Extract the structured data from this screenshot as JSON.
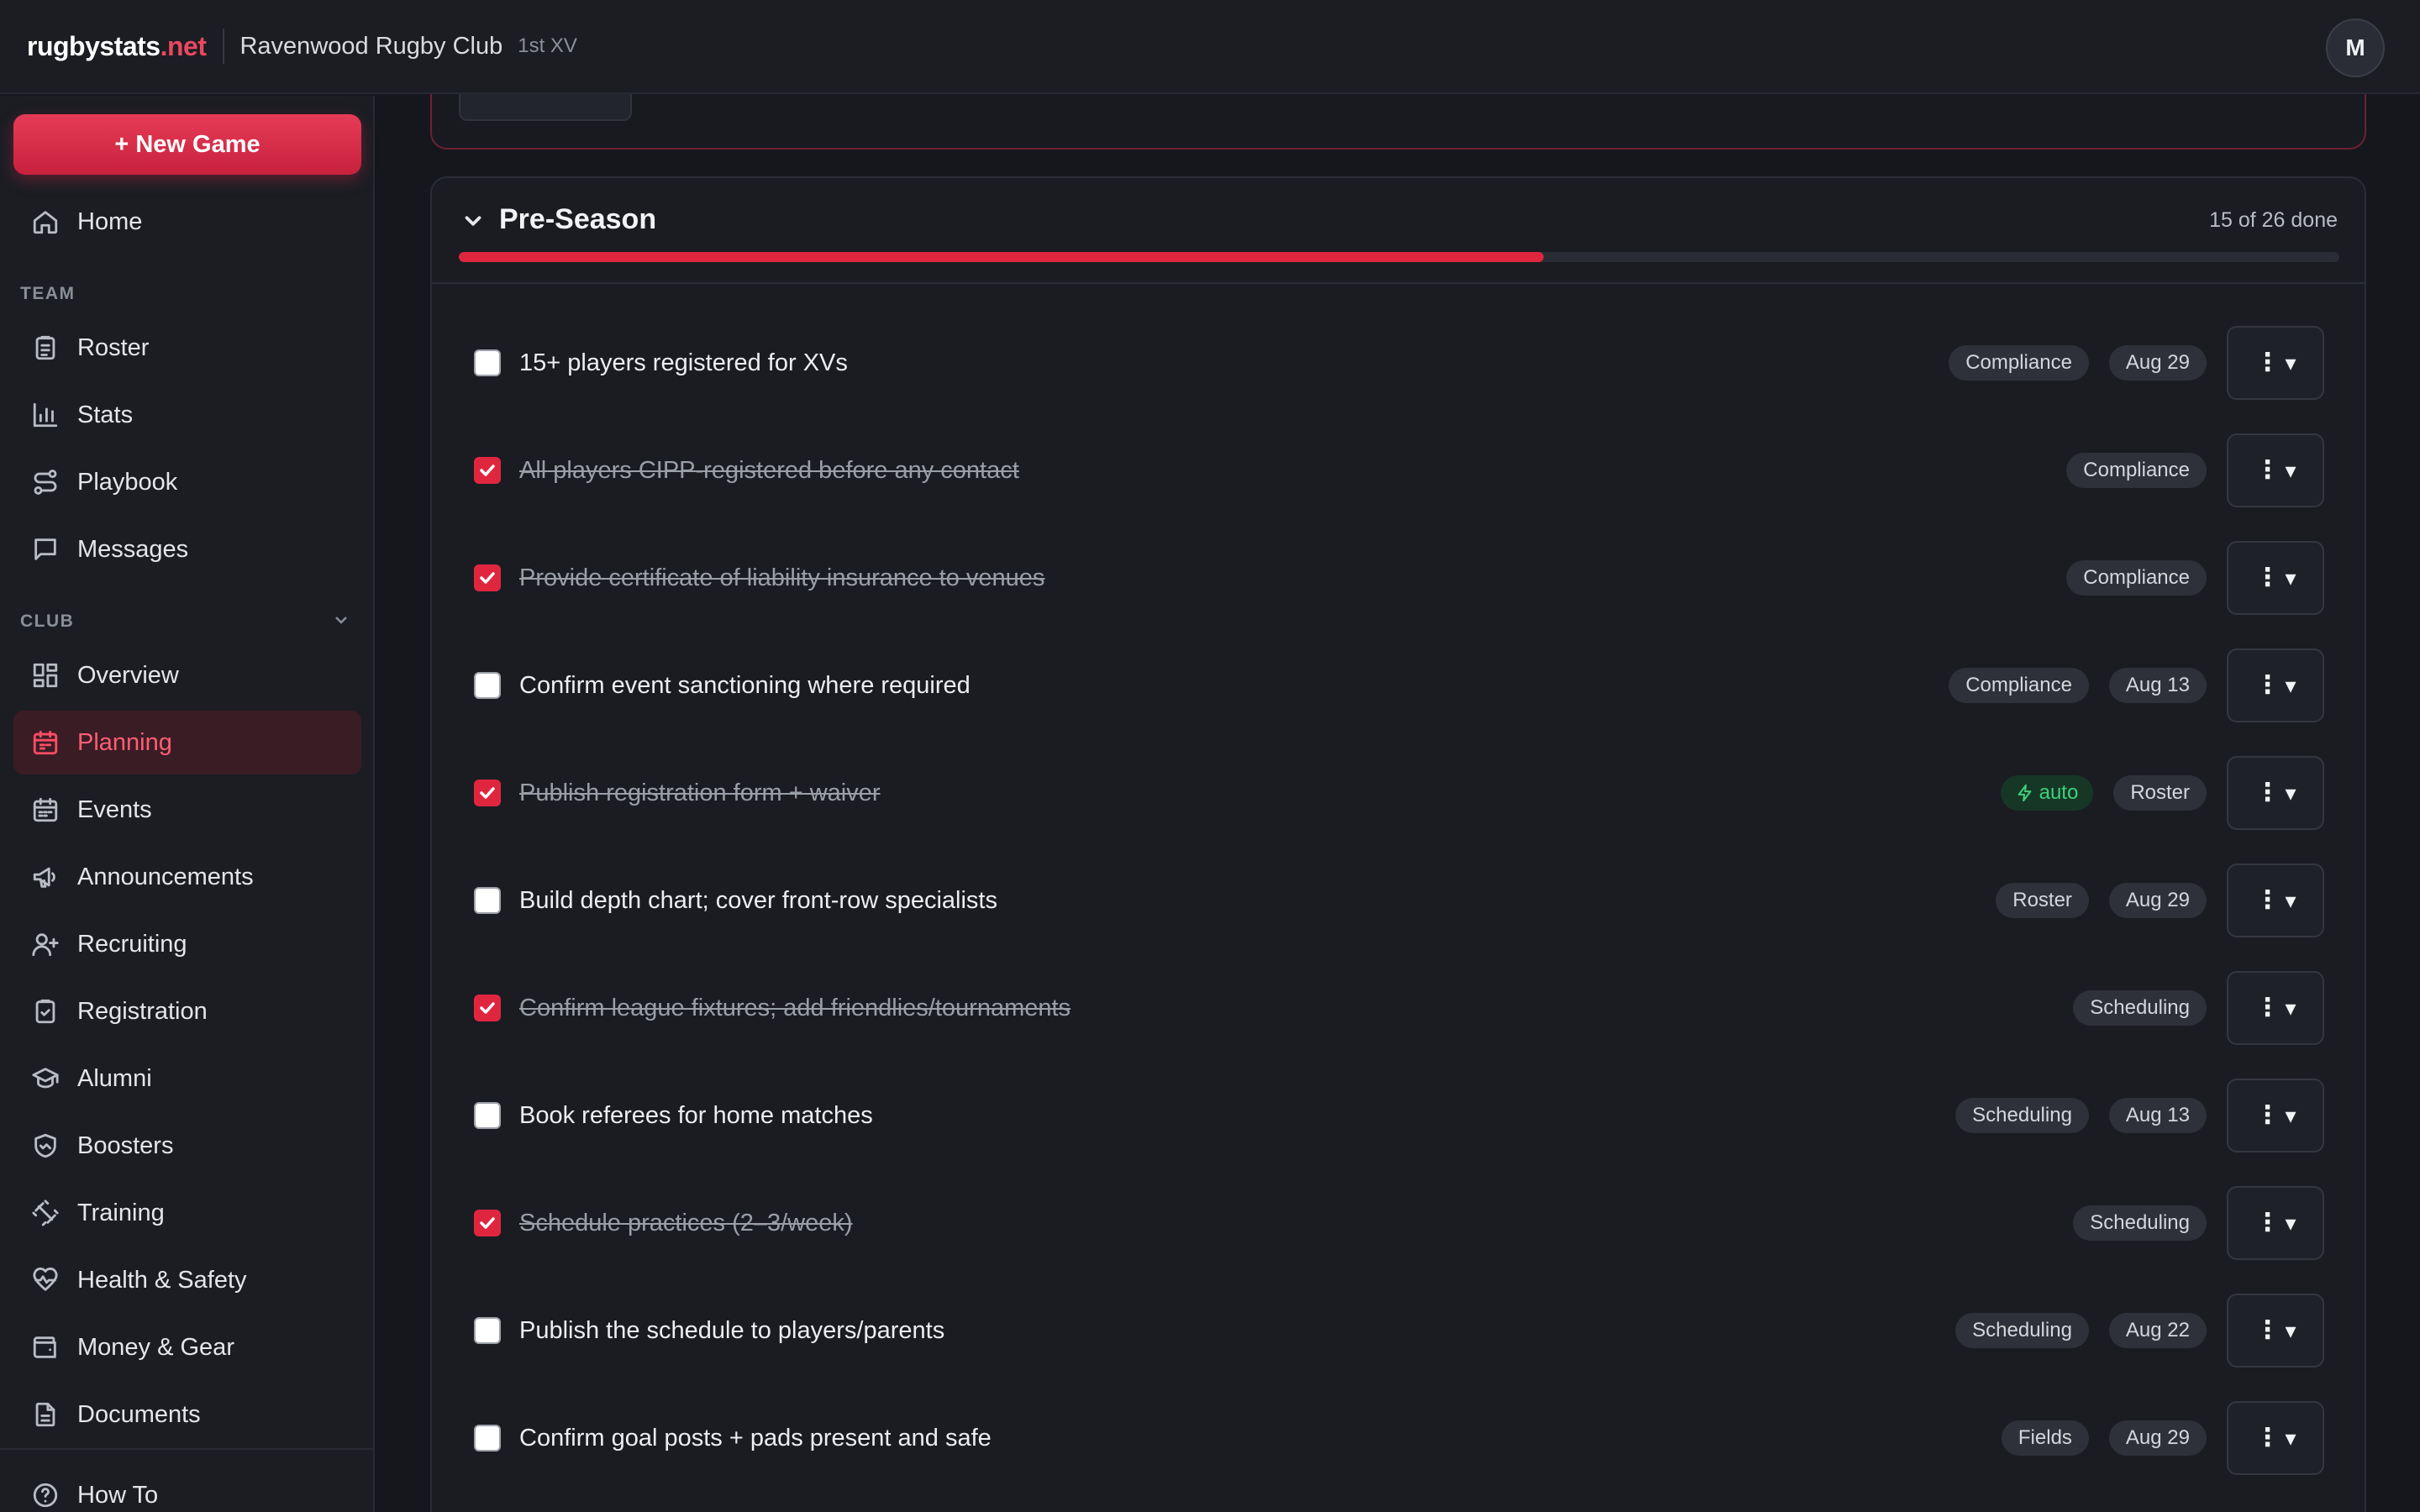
{
  "header": {
    "brand_main": "rugbystats",
    "brand_tld": ".net",
    "club_name": "Ravenwood Rugby Club",
    "team": "1st XV",
    "avatar_initial": "M"
  },
  "sidebar": {
    "new_game_label": "+ New Game",
    "home_label": "Home",
    "team_section": "TEAM",
    "team_items": [
      "Roster",
      "Stats",
      "Playbook",
      "Messages"
    ],
    "club_section": "CLUB",
    "club_items": [
      "Overview",
      "Planning",
      "Events",
      "Announcements",
      "Recruiting",
      "Registration",
      "Alumni",
      "Boosters",
      "Training",
      "Health & Safety",
      "Money & Gear",
      "Documents"
    ],
    "active_item": "Planning",
    "footer_item": "How To"
  },
  "checklist": {
    "title": "Pre-Season",
    "done_label": "15 of 26 done",
    "progress_fraction": 0.577,
    "accent_color": "#e0263f",
    "menu_label": "▾",
    "tasks": [
      {
        "text": "15+ players registered for XVs",
        "done": false,
        "tags": [
          "Compliance",
          "Aug 29"
        ],
        "auto": false
      },
      {
        "text": "All players CIPP-registered before any contact",
        "done": true,
        "tags": [
          "Compliance"
        ],
        "auto": false
      },
      {
        "text": "Provide certificate of liability insurance to venues",
        "done": true,
        "tags": [
          "Compliance"
        ],
        "auto": false
      },
      {
        "text": "Confirm event sanctioning where required",
        "done": false,
        "tags": [
          "Compliance",
          "Aug 13"
        ],
        "auto": false
      },
      {
        "text": "Publish registration form + waiver",
        "done": true,
        "tags": [
          "Roster"
        ],
        "auto": true,
        "auto_label": "auto"
      },
      {
        "text": "Build depth chart; cover front-row specialists",
        "done": false,
        "tags": [
          "Roster",
          "Aug 29"
        ],
        "auto": false
      },
      {
        "text": "Confirm league fixtures; add friendlies/tournaments",
        "done": true,
        "tags": [
          "Scheduling"
        ],
        "auto": false
      },
      {
        "text": "Book referees for home matches",
        "done": false,
        "tags": [
          "Scheduling",
          "Aug 13"
        ],
        "auto": false
      },
      {
        "text": "Schedule practices (2–3/week)",
        "done": true,
        "tags": [
          "Scheduling"
        ],
        "auto": false
      },
      {
        "text": "Publish the schedule to players/parents",
        "done": false,
        "tags": [
          "Scheduling",
          "Aug 22"
        ],
        "auto": false
      },
      {
        "text": "Confirm goal posts + pads present and safe",
        "done": false,
        "tags": [
          "Fields",
          "Aug 29"
        ],
        "auto": false
      }
    ]
  }
}
